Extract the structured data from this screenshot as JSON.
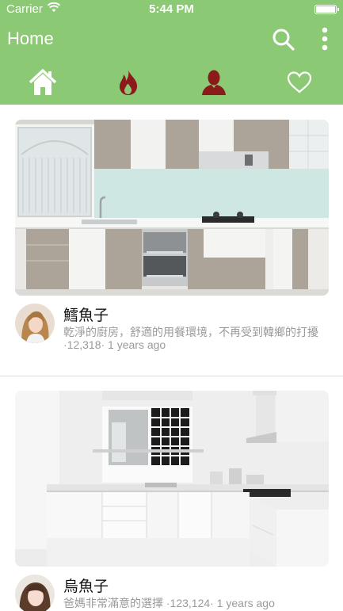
{
  "status_bar": {
    "carrier": "Carrier",
    "time": "5:44 PM"
  },
  "app_bar": {
    "title": "Home"
  },
  "tabs": [
    {
      "name": "home",
      "icon": "home-icon",
      "active": true
    },
    {
      "name": "hot",
      "icon": "flame-icon",
      "active": false
    },
    {
      "name": "profile",
      "icon": "person-icon",
      "active": false
    },
    {
      "name": "favorites",
      "icon": "heart-icon",
      "active": false
    }
  ],
  "posts": [
    {
      "author": "鱈魚子",
      "description": "乾淨的廚房，舒適的用餐環境，不再受到韓鄉的打擾",
      "meta": "·12,318· 1 years ago",
      "photo": "kitchen-wood-white"
    },
    {
      "author": "烏魚子",
      "description": "爸媽非常滿意的選擇 ·123,124· 1 years ago",
      "meta": "",
      "photo": "kitchen-all-white"
    }
  ],
  "colors": {
    "accent": "#8bc975",
    "tab_icon_dark": "#8b1a1a",
    "secondary_text": "#9a9a9a"
  }
}
